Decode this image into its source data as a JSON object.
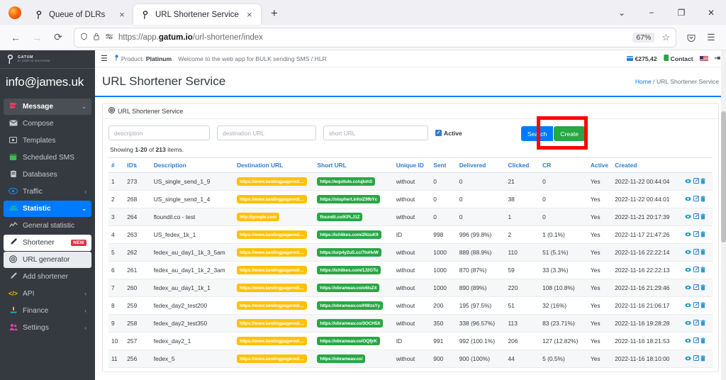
{
  "browser": {
    "tabs": [
      {
        "title": "Queue of DLRs",
        "active": false
      },
      {
        "title": "URL Shortener Service",
        "active": true
      }
    ],
    "new_tab_label": "+",
    "close_label": "×",
    "tab_list_chevron": "⌄",
    "window_minimize": "−",
    "window_maximize": "❐",
    "window_close": "✕",
    "back_label": "←",
    "forward_label": "→",
    "reload_label": "⟳",
    "url_prefix": "https://app.",
    "url_domain": "gatum.io",
    "url_suffix": "/url-shortener/index",
    "zoom_level": "67%",
    "bookmark_label": "☆",
    "pocket_label": "⌵",
    "menu_label": "☰"
  },
  "sidebar": {
    "brand_name": "GATUM",
    "brand_sub": "BY SEMPLIS SOLUTIONS",
    "user_email": "info@james.uk",
    "items": [
      {
        "label": "Message",
        "icon": "message-icon",
        "arrow": "⌄",
        "state": "open"
      },
      {
        "label": "Compose",
        "icon": "envelope-icon",
        "arrow": "",
        "state": "normal"
      },
      {
        "label": "Templates",
        "icon": "template-icon",
        "arrow": "",
        "state": "normal"
      },
      {
        "label": "Scheduled SMS",
        "icon": "calendar-icon",
        "arrow": "",
        "state": "normal"
      },
      {
        "label": "Databases",
        "icon": "database-icon",
        "arrow": "",
        "state": "normal"
      },
      {
        "label": "Traffic",
        "icon": "traffic-icon",
        "arrow": "‹",
        "state": "normal"
      },
      {
        "label": "Statistic",
        "icon": "statistic-icon",
        "arrow": "⌄",
        "state": "active"
      },
      {
        "label": "General statistic",
        "icon": "chart-line-icon",
        "arrow": "",
        "state": "normal"
      },
      {
        "label": "Shortener",
        "icon": "pencil-icon",
        "arrow": "",
        "state": "white",
        "badge": "NEW"
      },
      {
        "label": "URL generator",
        "icon": "target-icon",
        "arrow": "",
        "state": "greyish"
      },
      {
        "label": "Add shortener",
        "icon": "add-pencil-icon",
        "arrow": "",
        "state": "normal"
      },
      {
        "label": "API",
        "icon": "code-icon",
        "arrow": "‹",
        "state": "normal"
      },
      {
        "label": "Finance",
        "icon": "finance-icon",
        "arrow": "‹",
        "state": "normal"
      },
      {
        "label": "Settings",
        "icon": "settings-people-icon",
        "arrow": "‹",
        "state": "normal"
      }
    ]
  },
  "topbar": {
    "hamburger": "☰",
    "product_label": "Product:",
    "product_value": "Platinum",
    "welcome": "Welcome to the web app for BULK sending SMS / HLR",
    "balance": "€275,42",
    "contact": "Contact",
    "flag": "US",
    "logout": "⇥"
  },
  "page": {
    "title": "URL Shortener Service",
    "breadcrumb_home": "Home",
    "breadcrumb_sep": "/",
    "breadcrumb_current": "URL Shortener Service",
    "card_title": "URL Shortener Service",
    "showing_prefix": "Showing",
    "showing_range": "1-20",
    "showing_of": "of",
    "showing_total": "213",
    "showing_suffix": "items."
  },
  "filters": {
    "description_placeholder": "description",
    "description_value": "",
    "destination_placeholder": "destination URL",
    "destination_value": "",
    "short_placeholder": "short URL",
    "short_value": "",
    "active_label": "Active",
    "active_checked": true,
    "search_label": "Search",
    "create_label": "Create"
  },
  "table": {
    "columns": [
      "#",
      "ID",
      "Description",
      "Destination URL",
      "Short URL",
      "Unique ID",
      "Sent",
      "Delivered",
      "Clicked",
      "CR",
      "Active",
      "Created",
      ""
    ],
    "sort_icon": "⇅",
    "rows": [
      {
        "n": "1",
        "id": "273",
        "description": "US_single_send_1_9",
        "destination": "https://www.landingpageredi…",
        "short": "https://equitulo.cc/ujIohS",
        "unique_id": "without",
        "sent": "0",
        "delivered": "0",
        "clicked": "21",
        "cr": "0",
        "active": "Yes",
        "created": "2022-11-22 00:44:04"
      },
      {
        "n": "2",
        "id": "268",
        "description": "US_single_send_1_4",
        "destination": "https://www.landingpageredi…",
        "short": "https://stophert.info/Z9fbYc",
        "unique_id": "without",
        "sent": "0",
        "delivered": "0",
        "clicked": "38",
        "cr": "0",
        "active": "Yes",
        "created": "2022-11-22 00:44:01"
      },
      {
        "n": "3",
        "id": "264",
        "description": "floundil.co - test",
        "destination": "http://google.com",
        "short": "floundil.co/KPLJ1Z",
        "unique_id": "without",
        "sent": "0",
        "delivered": "0",
        "clicked": "1",
        "cr": "0",
        "active": "Yes",
        "created": "2022-11-21 20:17:39"
      },
      {
        "n": "4",
        "id": "263",
        "description": "US_fedex_1k_1",
        "destination": "https://www.landingpageredi…",
        "short": "https://ichlikes.com/2NzuK9",
        "unique_id": "ID",
        "sent": "998",
        "delivered": "996 (99.8%)",
        "clicked": "2",
        "cr": "1 (0.1%)",
        "active": "Yes",
        "created": "2022-11-17 21:47:26"
      },
      {
        "n": "5",
        "id": "262",
        "description": "fedex_au_day1_1k_3_5am",
        "destination": "https://www.landingpageredi…",
        "short": "https://urp4y2uS.cc/7toHvW",
        "unique_id": "without",
        "sent": "1000",
        "delivered": "889 (88.9%)",
        "clicked": "110",
        "cr": "51 (5.1%)",
        "active": "Yes",
        "created": "2022-11-16 22:22:14"
      },
      {
        "n": "6",
        "id": "261",
        "description": "fedex_au_day1_1k_2_3am",
        "destination": "https://www.landingpageredi…",
        "short": "https://ichlikes.com/1J2GTu",
        "unique_id": "without",
        "sent": "1000",
        "delivered": "870 (87%)",
        "clicked": "59",
        "cr": "33 (3.3%)",
        "active": "Yes",
        "created": "2022-11-16 22:22:13"
      },
      {
        "n": "7",
        "id": "260",
        "description": "fedex_au_day1_1k_1",
        "destination": "https://www.landingpageredi…",
        "short": "https://obrameav.co/o6IsZ4",
        "unique_id": "without",
        "sent": "1000",
        "delivered": "890 (89%)",
        "clicked": "220",
        "cr": "108 (10.8%)",
        "active": "Yes",
        "created": "2022-11-16 21:29:46"
      },
      {
        "n": "8",
        "id": "259",
        "description": "fedex_day2_test200",
        "destination": "https://www.landingpageredi…",
        "short": "https://obrameav.co/HWzsYy",
        "unique_id": "without",
        "sent": "200",
        "delivered": "195 (97.5%)",
        "clicked": "51",
        "cr": "32 (16%)",
        "active": "Yes",
        "created": "2022-11-16 21:06:17"
      },
      {
        "n": "9",
        "id": "258",
        "description": "fedex_day2_test350",
        "destination": "https://www.landingpageredi…",
        "short": "https://obrameav.co/3OCH5X",
        "unique_id": "without",
        "sent": "350",
        "delivered": "338 (96.57%)",
        "clicked": "113",
        "cr": "83 (23.71%)",
        "active": "Yes",
        "created": "2022-11-16 19:28:28"
      },
      {
        "n": "10",
        "id": "257",
        "description": "fedex_day2_1",
        "destination": "https://www.landingpageredi…",
        "short": "https://obrameav.co/OQfjrK",
        "unique_id": "ID",
        "sent": "991",
        "delivered": "992 (100.1%)",
        "clicked": "206",
        "cr": "127 (12.82%)",
        "active": "Yes",
        "created": "2022-11-16 18:21:53"
      },
      {
        "n": "11",
        "id": "256",
        "description": "fedex_5",
        "destination": "https://www.landingpageredi…",
        "short": "https://obrameav.co/",
        "unique_id": "without",
        "sent": "900",
        "delivered": "900 (100%)",
        "clicked": "44",
        "cr": "5 (0.5%)",
        "active": "Yes",
        "created": "2022-11-16 18:10:00"
      }
    ],
    "actions": {
      "view": "view-icon",
      "edit": "edit-icon",
      "delete": "delete-icon"
    }
  },
  "colors": {
    "primary": "#007bff",
    "success": "#28a745",
    "warning": "#ffc107",
    "sidebar_bg": "#343a40",
    "highlight_box": "#ff0000"
  }
}
